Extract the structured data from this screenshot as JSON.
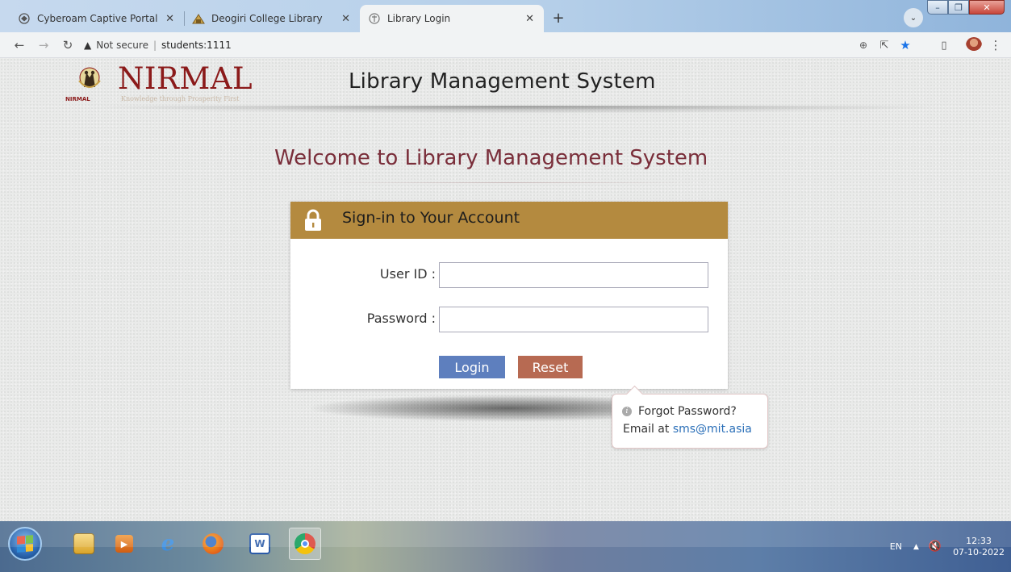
{
  "browser": {
    "tabs": [
      {
        "title": "Cyberoam Captive Portal",
        "icon": "globe-icon",
        "active": false
      },
      {
        "title": "Deogiri College Library",
        "icon": "college-icon",
        "active": false
      },
      {
        "title": "Library Login",
        "icon": "library-icon",
        "active": true
      }
    ],
    "new_tab": "+",
    "url": {
      "security": "Not secure",
      "host": "students:1111"
    }
  },
  "header": {
    "logo_text": "NIRMAL",
    "logo_sub": "NIRMAL",
    "logo_tagline": "Knowledge through Prosperity First",
    "title": "Library Management System"
  },
  "welcome": "Welcome to Library Management System",
  "login": {
    "heading": "Sign-in to Your Account",
    "user_label": "User ID :",
    "password_label": "Password :",
    "user_value": "",
    "password_value": "",
    "login_button": "Login",
    "reset_button": "Reset"
  },
  "tooltip": {
    "line1": "Forgot Password?",
    "email_prefix": "Email at ",
    "email": "sms@mit.asia"
  },
  "taskbar": {
    "apps": [
      "file-explorer-icon",
      "media-player-icon",
      "internet-explorer-icon",
      "firefox-icon",
      "word-icon",
      "chrome-icon"
    ],
    "language": "EN",
    "time": "12:33",
    "date": "07-10-2022"
  },
  "colors": {
    "accent_header": "#b48a3f",
    "login_button": "#5e7fbe",
    "reset_button": "#b76a52",
    "welcome_text": "#7a2e3a",
    "logo_text": "#8b1a1a"
  }
}
